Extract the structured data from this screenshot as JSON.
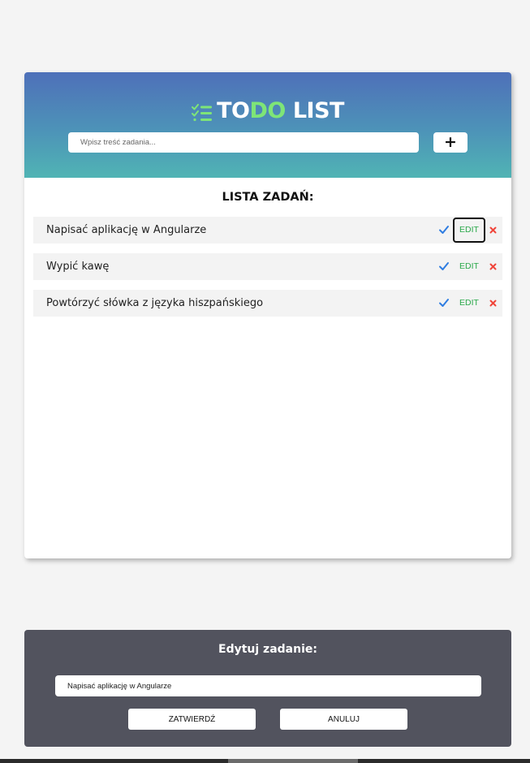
{
  "header": {
    "title_part1": "TO",
    "title_accent": "DO",
    "title_part2": "LIST",
    "logo_icon": "checklist-icon",
    "accent_color": "#7ee577",
    "gradient": [
      "#4e70b9",
      "#50b4b4"
    ]
  },
  "new_task": {
    "placeholder": "Wpisz treść zadania...",
    "value": "",
    "add_label": "+"
  },
  "list": {
    "title": "LISTA ZADAŃ:",
    "items": [
      {
        "text": "Napisać aplikację w Angularze",
        "edit_label": "EDIT",
        "edit_focused": true
      },
      {
        "text": "Wypić kawę",
        "edit_label": "EDIT",
        "edit_focused": false
      },
      {
        "text": "Powtórzyć słówka z języka hiszpańskiego",
        "edit_label": "EDIT",
        "edit_focused": false
      }
    ],
    "icons": {
      "done": "checkmark-icon",
      "delete": "close-icon"
    },
    "colors": {
      "done": "#2f7de1",
      "edit": "#2aa84a",
      "delete": "#f0453a"
    }
  },
  "edit_panel": {
    "title": "Edytuj zadanie:",
    "input_value": "Napisać aplikację w Angularze",
    "confirm_label": "ZATWIERDŹ",
    "cancel_label": "ANULUJ",
    "background": "#52535e"
  }
}
